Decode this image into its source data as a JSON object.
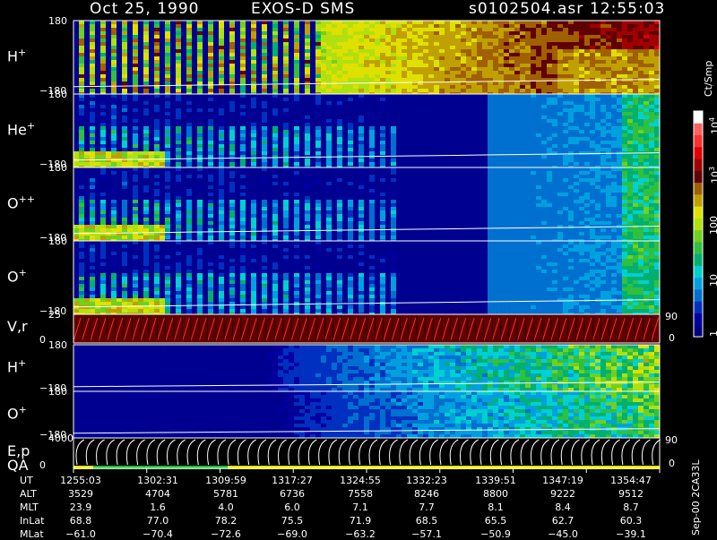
{
  "header": {
    "date": "Oct 25, 1990",
    "instrument": "EXOS-D SMS",
    "file": "s0102504.asr",
    "time": "12:55:03"
  },
  "panels": [
    {
      "label": "H",
      "sup": "+",
      "top": "180",
      "bottom": "−180",
      "right": ""
    },
    {
      "label": "He",
      "sup": "+",
      "top": "180",
      "bottom": "−180",
      "right": ""
    },
    {
      "label": "O",
      "sup": "++",
      "top": "180",
      "bottom": "−180",
      "right": ""
    },
    {
      "label": "O",
      "sup": "+",
      "top": "180",
      "bottom": "−180",
      "right": ""
    },
    {
      "label": "V,r",
      "sup": "",
      "top": "25",
      "bottom": "0",
      "right_top": "90",
      "right_bottom": "0"
    },
    {
      "label": "H",
      "sup": "+",
      "top": "180",
      "bottom": "−180",
      "right": ""
    },
    {
      "label": "O",
      "sup": "+",
      "top": "180",
      "bottom": "−180",
      "right": ""
    },
    {
      "label": "E,p",
      "label2": "QA",
      "sup": "",
      "top": "4000",
      "bottom": "0",
      "right_top": "90",
      "right_bottom": "0"
    }
  ],
  "colorbar": {
    "title": "Ct/Smp",
    "labels": [
      "1",
      "10",
      "100",
      "10",
      "10"
    ],
    "exponents": [
      "",
      "",
      "",
      "3",
      "4"
    ],
    "colors": [
      "#000080",
      "#0000a0",
      "#0030c0",
      "#0070d0",
      "#00a0e0",
      "#00d0d0",
      "#00b070",
      "#30c040",
      "#70d020",
      "#b0e010",
      "#e0e000",
      "#c0a000",
      "#a06000",
      "#600000",
      "#a00000",
      "#e00000",
      "#ff3030",
      "#ff6060",
      "#ffffff"
    ]
  },
  "ephemeris": {
    "rows": [
      {
        "name": "UT",
        "values": [
          "1255:03",
          "1302:31",
          "1309:59",
          "1317:27",
          "1324:55",
          "1332:23",
          "1339:51",
          "1347:19",
          "1354:47"
        ]
      },
      {
        "name": "ALT",
        "values": [
          "3529",
          "4704",
          "5781",
          "6736",
          "7558",
          "8246",
          "8800",
          "9222",
          "9512"
        ]
      },
      {
        "name": "MLT",
        "values": [
          "23.9",
          "1.6",
          "4.0",
          "6.0",
          "7.1",
          "7.7",
          "8.1",
          "8.4",
          "8.7"
        ]
      },
      {
        "name": "InLat",
        "values": [
          "68.8",
          "77.0",
          "78.2",
          "75.5",
          "71.9",
          "68.5",
          "65.5",
          "62.7",
          "60.3"
        ]
      },
      {
        "name": "MLat",
        "values": [
          "−61.0",
          "−70.4",
          "−72.6",
          "−69.0",
          "−63.2",
          "−57.1",
          "−50.9",
          "−45.0",
          "−39.1"
        ]
      }
    ]
  },
  "footer_id": "Sep-00 2CA33L",
  "chart_data": {
    "type": "heatmap",
    "title": "Oct 25, 1990   EXOS-D SMS",
    "x": [
      "1255:03",
      "1302:31",
      "1309:59",
      "1317:27",
      "1324:55",
      "1332:23",
      "1339:51",
      "1347:19",
      "1354:47"
    ],
    "series": [
      {
        "name": "H+",
        "ylim": [
          -180,
          180
        ]
      },
      {
        "name": "He+",
        "ylim": [
          -180,
          180
        ]
      },
      {
        "name": "O++",
        "ylim": [
          -180,
          180
        ]
      },
      {
        "name": "O+",
        "ylim": [
          -180,
          180
        ]
      },
      {
        "name": "V,r",
        "ylim": [
          0,
          25
        ]
      },
      {
        "name": "H+",
        "ylim": [
          -180,
          180
        ]
      },
      {
        "name": "O+",
        "ylim": [
          -180,
          180
        ]
      },
      {
        "name": "E,p",
        "ylim": [
          0,
          4000
        ]
      }
    ],
    "colorscale": {
      "label": "Ct/Smp",
      "ticks": [
        "1",
        "10",
        "100",
        "10^3",
        "10^4"
      ]
    }
  }
}
